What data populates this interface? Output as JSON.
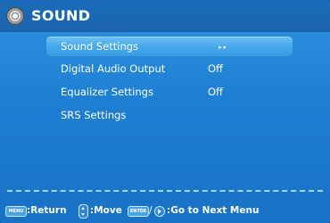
{
  "header": {
    "title": "SOUND",
    "icon": "speaker-disc-icon"
  },
  "menu": {
    "items": [
      {
        "label": "Sound Settings",
        "value": "▸▸",
        "selected": true
      },
      {
        "label": "Digital Audio Output",
        "value": "Off",
        "selected": false
      },
      {
        "label": "Equalizer Settings",
        "value": "Off",
        "selected": false
      },
      {
        "label": "SRS Settings",
        "value": "",
        "selected": false
      }
    ]
  },
  "footer": {
    "menu_key": "MENU",
    "return_text": ":Return",
    "move_text": ":Move",
    "enter_key": "ENTER",
    "slash": "/",
    "next_text": ":Go to Next Menu"
  },
  "colors": {
    "background": "#1d7fd3",
    "header": "#1a6cb8",
    "selected_highlight": "#42a6ea",
    "text": "#ffffff"
  }
}
